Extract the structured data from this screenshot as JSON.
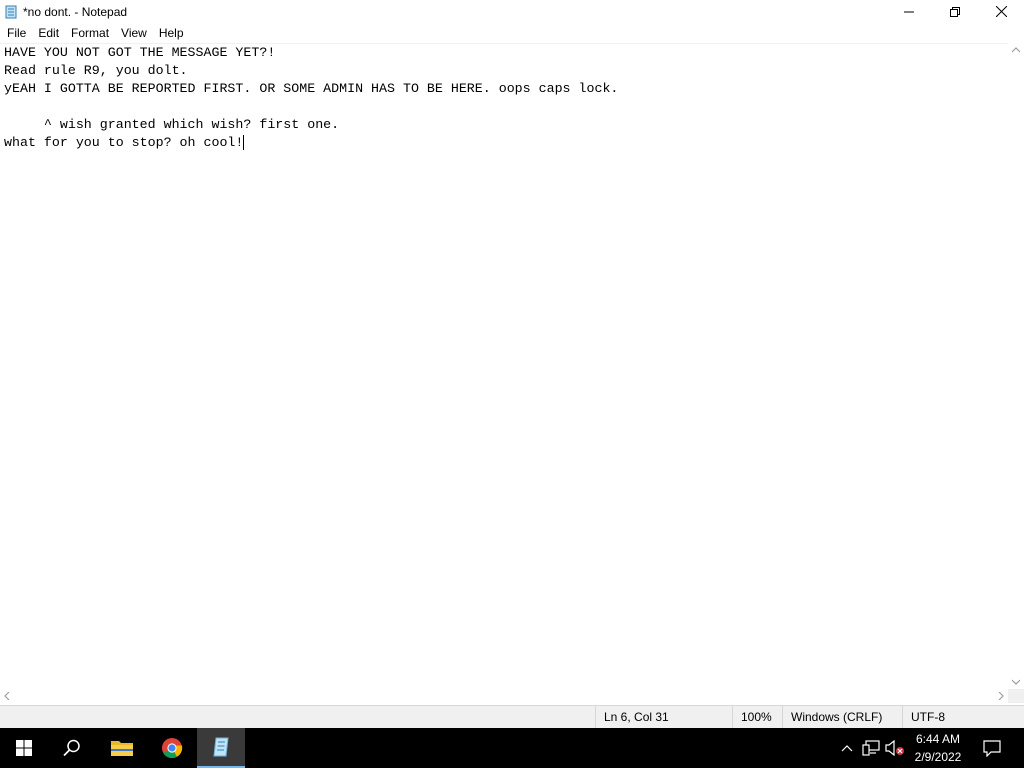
{
  "window": {
    "title": "*no dont. - Notepad",
    "controls": [
      "minimize-icon",
      "restore-icon",
      "close-icon"
    ]
  },
  "menu": {
    "items": [
      "File",
      "Edit",
      "Format",
      "View",
      "Help"
    ]
  },
  "editor": {
    "lines": [
      "HAVE YOU NOT GOT THE MESSAGE YET?!",
      "Read rule R9, you dolt.",
      "yEAH I GOTTA BE REPORTED FIRST. OR SOME ADMIN HAS TO BE HERE. oops caps lock.",
      "",
      "     ^ wish granted which wish? first one.",
      "what for you to stop? oh cool!"
    ]
  },
  "status": {
    "position": "Ln 6, Col 31",
    "zoom": "100%",
    "line_ending": "Windows (CRLF)",
    "encoding": "UTF-8"
  },
  "taskbar": {
    "apps": [
      "start-icon",
      "search-icon",
      "file-explorer-icon",
      "chrome-icon",
      "notepad-icon"
    ],
    "active_app": "notepad-icon",
    "tray_icons": [
      "chevron-up-icon",
      "network-icon",
      "volume-muted-icon",
      "notifications-icon"
    ],
    "time": "6:44 AM",
    "date": "2/9/2022",
    "accent_color": "#76b9ed"
  }
}
